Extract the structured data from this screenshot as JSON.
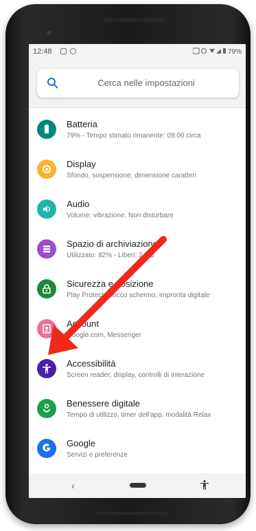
{
  "status": {
    "time": "12:48",
    "battery": "79%"
  },
  "search": {
    "placeholder": "Cerca nelle impostazioni"
  },
  "items": [
    {
      "title": "Batteria",
      "subtitle": "79% - Tempo stimato rimanente: 09:00 circa",
      "color": "#00897b",
      "icon": "battery-icon"
    },
    {
      "title": "Display",
      "subtitle": "Sfondo, sospensione, dimensione caratteri",
      "color": "#fbb22f",
      "icon": "brightness-icon"
    },
    {
      "title": "Audio",
      "subtitle": "Volume, vibrazione, Non disturbare",
      "color": "#1eb5a6",
      "icon": "volume-icon"
    },
    {
      "title": "Spazio di archiviazione",
      "subtitle": "Utilizzato: 82% - Liberi: 2 GB",
      "color": "#9c4dcc",
      "icon": "storage-icon"
    },
    {
      "title": "Sicurezza e posizione",
      "subtitle": "Play Protect, blocco schermo, impronta digitale",
      "color": "#1a8a3a",
      "icon": "lock-icon"
    },
    {
      "title": "Account",
      "subtitle": "Google.com, Messenger",
      "color": "#ec6f98",
      "icon": "account-icon"
    },
    {
      "title": "Accessibilità",
      "subtitle": "Screen reader, display, controlli di interazione",
      "color": "#4a1fb0",
      "icon": "accessibility-icon"
    },
    {
      "title": "Benessere digitale",
      "subtitle": "Tempo di utilizzo, timer dell'app, modalità Relax",
      "color": "#1e9d4d",
      "icon": "wellbeing-icon"
    },
    {
      "title": "Google",
      "subtitle": "Servizi e preferenze",
      "color": "#1a73e8",
      "icon": "google-icon"
    }
  ],
  "annotation": {
    "color": "#ee2a1b"
  }
}
